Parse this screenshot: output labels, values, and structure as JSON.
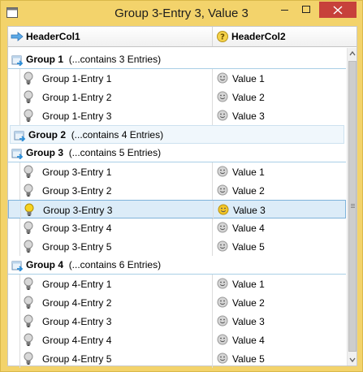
{
  "window": {
    "title": "Group 3-Entry 3, Value 3"
  },
  "header": {
    "col1": "HeaderCol1",
    "col2": "HeaderCol2"
  },
  "groups": [
    {
      "name": "Group 1",
      "summary": "(...contains 3 Entries)",
      "expanded": true,
      "entries": [
        {
          "label": "Group 1-Entry 1",
          "value": "Value 1"
        },
        {
          "label": "Group 1-Entry 2",
          "value": "Value 2"
        },
        {
          "label": "Group 1-Entry 3",
          "value": "Value 3"
        }
      ]
    },
    {
      "name": "Group 2",
      "summary": "(...contains 4 Entries)",
      "expanded": false,
      "entries": []
    },
    {
      "name": "Group 3",
      "summary": "(...contains 5 Entries)",
      "expanded": true,
      "entries": [
        {
          "label": "Group 3-Entry 1",
          "value": "Value 1"
        },
        {
          "label": "Group 3-Entry 2",
          "value": "Value 2"
        },
        {
          "label": "Group 3-Entry 3",
          "value": "Value 3",
          "selected": true
        },
        {
          "label": "Group 3-Entry 4",
          "value": "Value 4"
        },
        {
          "label": "Group 3-Entry 5",
          "value": "Value 5"
        }
      ]
    },
    {
      "name": "Group 4",
      "summary": "(...contains 6 Entries)",
      "expanded": true,
      "entries": [
        {
          "label": "Group 4-Entry 1",
          "value": "Value 1"
        },
        {
          "label": "Group 4-Entry 2",
          "value": "Value 2"
        },
        {
          "label": "Group 4-Entry 3",
          "value": "Value 3"
        },
        {
          "label": "Group 4-Entry 4",
          "value": "Value 4"
        },
        {
          "label": "Group 4-Entry 5",
          "value": "Value 5"
        }
      ]
    }
  ],
  "icons": {
    "group": "group-folder-icon",
    "entry": "lightbulb-icon",
    "value": "smiley-icon"
  },
  "colors": {
    "titlebar": "#f3d36b",
    "close_button": "#c7413b",
    "selection_fill": "#dcecf8",
    "selection_border": "#7fb3da",
    "group_separator": "#a9cfe6"
  }
}
